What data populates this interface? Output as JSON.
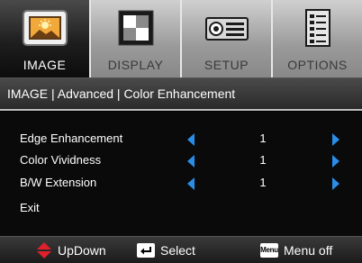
{
  "tabs": [
    {
      "label": "IMAGE",
      "icon": "image-icon",
      "active": true
    },
    {
      "label": "DISPLAY",
      "icon": "display-icon",
      "active": false
    },
    {
      "label": "SETUP",
      "icon": "projector-icon",
      "active": false
    },
    {
      "label": "OPTIONS",
      "icon": "options-list-icon",
      "active": false
    }
  ],
  "breadcrumb": "IMAGE | Advanced | Color Enhancement",
  "rows": [
    {
      "label": "Edge Enhancement",
      "value": "1",
      "arrows": true
    },
    {
      "label": "Color Vividness",
      "value": "1",
      "arrows": true
    },
    {
      "label": "B/W Extension",
      "value": "1",
      "arrows": true
    },
    {
      "label": "Exit",
      "value": "",
      "arrows": false
    }
  ],
  "footer": {
    "updown": "UpDown",
    "select": "Select",
    "menu_key": "Menu",
    "menu_off": "Menu off"
  },
  "colors": {
    "arrow": "#2a8ee8",
    "updown_icon": "#e0202a",
    "tab_active": "#1e1e1e",
    "tab_inactive": "#a8a8a8"
  }
}
